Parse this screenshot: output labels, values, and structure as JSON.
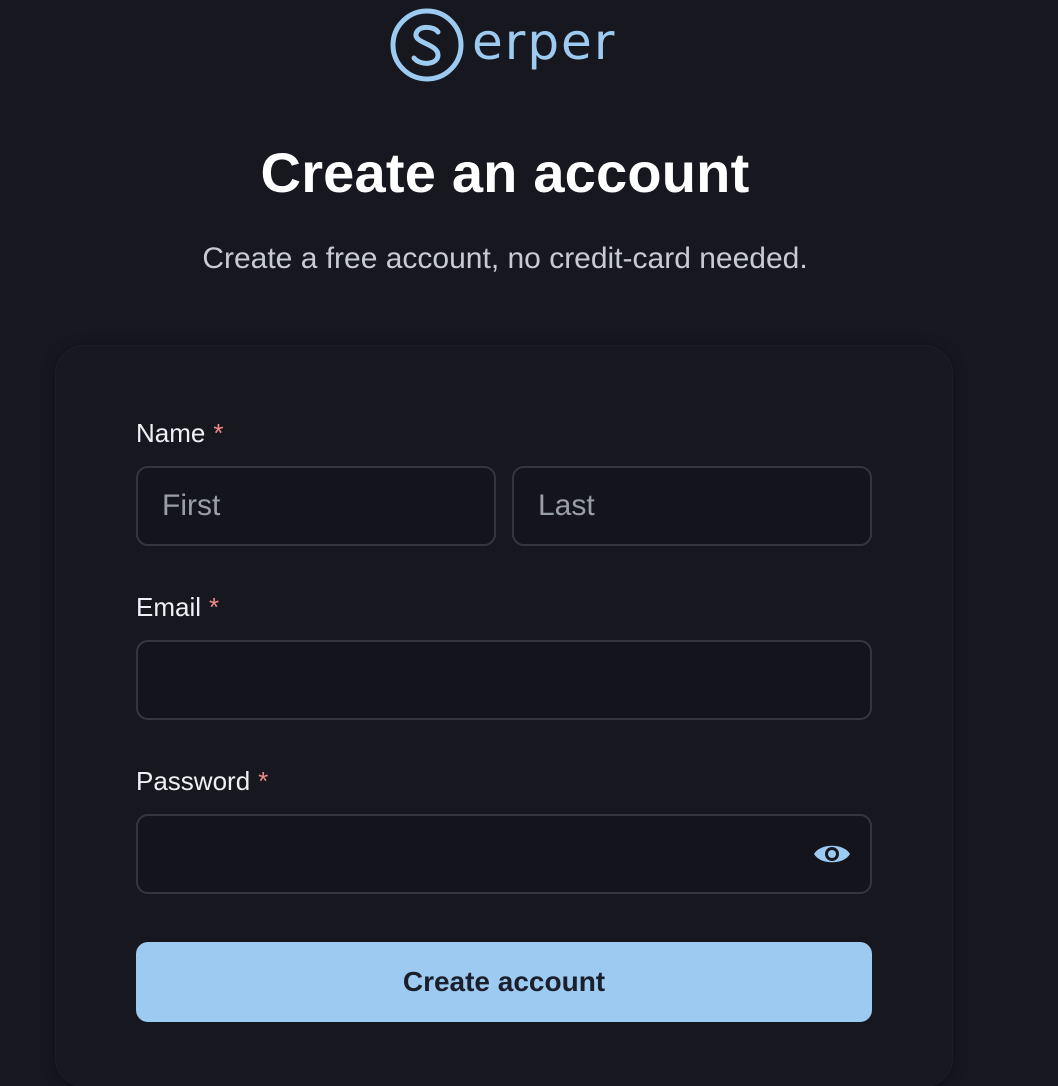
{
  "brand": {
    "logo_text": "erper",
    "logo_icon": "serper-s-logo-icon",
    "color": "#9ccaf0"
  },
  "header": {
    "title": "Create an account",
    "subtitle": "Create a free account, no credit-card needed."
  },
  "form": {
    "name": {
      "label": "Name",
      "required_mark": "*",
      "first": {
        "placeholder": "First",
        "value": ""
      },
      "last": {
        "placeholder": "Last",
        "value": ""
      }
    },
    "email": {
      "label": "Email",
      "required_mark": "*",
      "placeholder": "",
      "value": ""
    },
    "password": {
      "label": "Password",
      "required_mark": "*",
      "placeholder": "",
      "value": "",
      "toggle_icon": "eye-icon"
    },
    "submit_label": "Create account"
  },
  "colors": {
    "background": "#16171f",
    "accent": "#9ccaf0",
    "required": "#f08a86"
  }
}
